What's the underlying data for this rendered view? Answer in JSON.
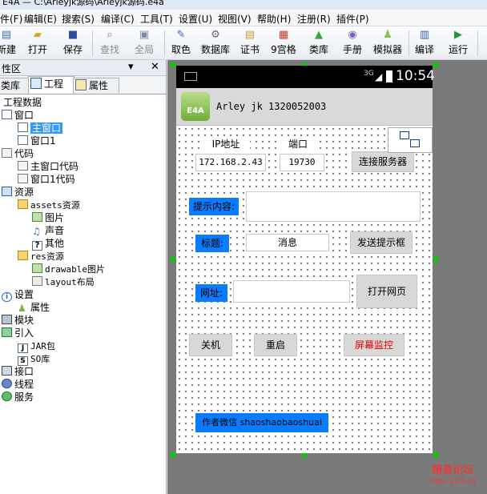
{
  "window": {
    "title": "E4A — C:\\Arleyjk源码\\Arleyjk源码.e4a"
  },
  "menu": [
    "件(F)",
    "编辑(E)",
    "搜索(S)",
    "编译(C)",
    "工具(T)",
    "设置(U)",
    "视图(V)",
    "帮助(H)",
    "注册(R)",
    "插件(P)"
  ],
  "toolbar": [
    {
      "label": "新建",
      "icon": "新",
      "color": "#3b6fb6"
    },
    {
      "label": "打开",
      "icon": "▰",
      "color": "#e0a21b"
    },
    {
      "label": "保存",
      "icon": "■",
      "color": "#2b4f9e"
    },
    {
      "label": "查找",
      "icon": "⌕",
      "color": "#7a7a7a"
    },
    {
      "label": "全局",
      "icon": "▣",
      "color": "#7a8aa0"
    },
    {
      "label": "取色",
      "icon": "✎",
      "color": "#2a6acb"
    },
    {
      "label": "数据库",
      "icon": "⚙",
      "color": "#6a6a6a"
    },
    {
      "label": "证书",
      "icon": "▤",
      "color": "#c99a2e"
    },
    {
      "label": "9宫格",
      "icon": "▦",
      "color": "#c0392b"
    },
    {
      "label": "类库",
      "icon": "▲",
      "color": "#3aa53a"
    },
    {
      "label": "手册",
      "icon": "◉",
      "color": "#7a5cc0"
    },
    {
      "label": "模拟器",
      "icon": "♟",
      "color": "#8bc34a"
    },
    {
      "label": "编译",
      "icon": "▥",
      "color": "#3a5ea8"
    },
    {
      "label": "运行",
      "icon": "▶",
      "color": "#1e9a2e"
    }
  ],
  "panel": {
    "title": "性区",
    "close": "✕",
    "pin": "▾"
  },
  "tabs": [
    "类库",
    "工程",
    "属性"
  ],
  "tree": [
    {
      "label": "工程数据",
      "indent": 0,
      "icon": ""
    },
    {
      "label": "窗口",
      "indent": 0,
      "icon": "win"
    },
    {
      "label": "主窗口",
      "indent": 1,
      "icon": "win",
      "selected": true
    },
    {
      "label": "窗口1",
      "indent": 1,
      "icon": "win"
    },
    {
      "label": "代码",
      "indent": 0,
      "icon": "doc"
    },
    {
      "label": "主窗口代码",
      "indent": 1,
      "icon": "doc"
    },
    {
      "label": "窗口1代码",
      "indent": 1,
      "icon": "doc"
    },
    {
      "label": "资源",
      "indent": 0,
      "icon": "res"
    },
    {
      "label": "assets资源",
      "indent": 1,
      "icon": "folder"
    },
    {
      "label": "图片",
      "indent": 2,
      "icon": "img"
    },
    {
      "label": "声音",
      "indent": 2,
      "icon": "snd"
    },
    {
      "label": "其他",
      "indent": 2,
      "icon": "q"
    },
    {
      "label": "res资源",
      "indent": 1,
      "icon": "folder"
    },
    {
      "label": "drawable图片",
      "indent": 2,
      "icon": "img"
    },
    {
      "label": "layout布局",
      "indent": 2,
      "icon": "lay"
    },
    {
      "label": "设置",
      "indent": 0,
      "icon": "info"
    },
    {
      "label": "属性",
      "indent": 1,
      "icon": "andr"
    },
    {
      "label": "模块",
      "indent": 0,
      "icon": "mod"
    },
    {
      "label": "引入",
      "indent": 0,
      "icon": "imp"
    },
    {
      "label": "JAR包",
      "indent": 1,
      "icon": "jar"
    },
    {
      "label": "SO库",
      "indent": 1,
      "icon": "so"
    },
    {
      "label": "接口",
      "indent": 0,
      "icon": "iface"
    },
    {
      "label": "线程",
      "indent": 0,
      "icon": "thr"
    },
    {
      "label": "服务",
      "indent": 0,
      "icon": "svc"
    }
  ],
  "phone": {
    "time": "10:54",
    "network": "3G",
    "app_title": "Arley jk 1320052003",
    "app_icon": "E4A",
    "ip_label": "IP地址",
    "port_label": "端口",
    "ip_value": "172.168.2.43",
    "port_value": "19730",
    "connect_button": "连接服务器",
    "hint_label": "提示内容:",
    "hint_value": "",
    "title_label": "标题:",
    "title_value": "消息",
    "send_button": "发送提示框",
    "url_label": "网址:",
    "url_value": "",
    "open_button": "打开网页",
    "shutdown_button": "关机",
    "restart_button": "重启",
    "monitor_button": "屏幕监控",
    "footer_label": "作者微信 shaoshaobaoshuai"
  },
  "colors": {
    "accent_blue": "#0a7cff",
    "monitor_text": "#e00000",
    "selection": "#3399ff"
  },
  "watermark": {
    "line1": "精易论坛",
    "line2": "bbs.125.la"
  }
}
